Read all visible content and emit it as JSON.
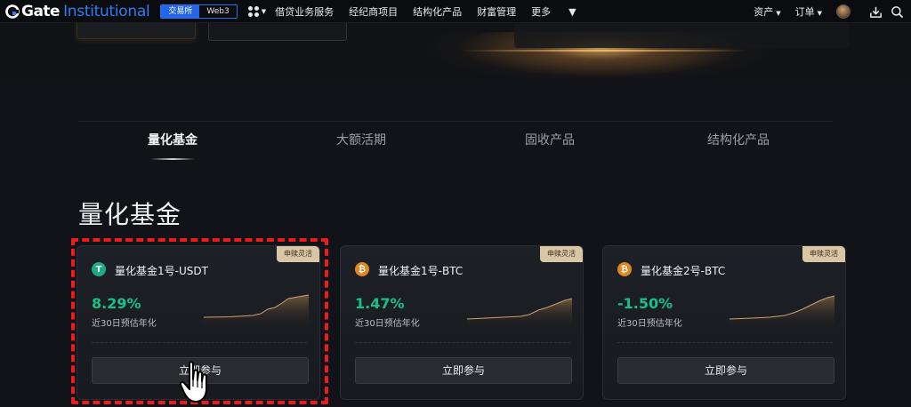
{
  "topnav": {
    "logo_gate": "Gate",
    "logo_suffix": "Institutional",
    "switch_exchange": "交易所",
    "switch_web3": "Web3",
    "links": [
      "借贷业务服务",
      "经纪商项目",
      "结构化产品",
      "财富管理",
      "更多"
    ],
    "assets": "资产",
    "orders": "订单",
    "brand_color": "#2e7df6"
  },
  "tabs": [
    {
      "label": "量化基金",
      "active": true
    },
    {
      "label": "大额活期",
      "active": false
    },
    {
      "label": "固收产品",
      "active": false
    },
    {
      "label": "结构化产品",
      "active": false
    }
  ],
  "section": {
    "title": "量化基金"
  },
  "cards": [
    {
      "badge": "申赎灵活",
      "coin_icon": "usdt-icon",
      "coin_glyph": "T",
      "name": "量化基金1号-USDT",
      "rate": "8.29%",
      "rate_label": "近30日预估年化",
      "button": "立即参与",
      "rate_color": "#18c18a"
    },
    {
      "badge": "申赎灵活",
      "coin_icon": "btc-icon",
      "coin_glyph": "₿",
      "name": "量化基金1号-BTC",
      "rate": "1.47%",
      "rate_label": "近30日预估年化",
      "button": "立即参与",
      "rate_color": "#18c18a"
    },
    {
      "badge": "申赎灵活",
      "coin_icon": "btc-icon",
      "coin_glyph": "₿",
      "name": "量化基金2号-BTC",
      "rate": "-1.50%",
      "rate_label": "近30日预估年化",
      "button": "立即参与",
      "rate_color": "#18c18a"
    }
  ],
  "highlight_color": "#ef1b1b"
}
